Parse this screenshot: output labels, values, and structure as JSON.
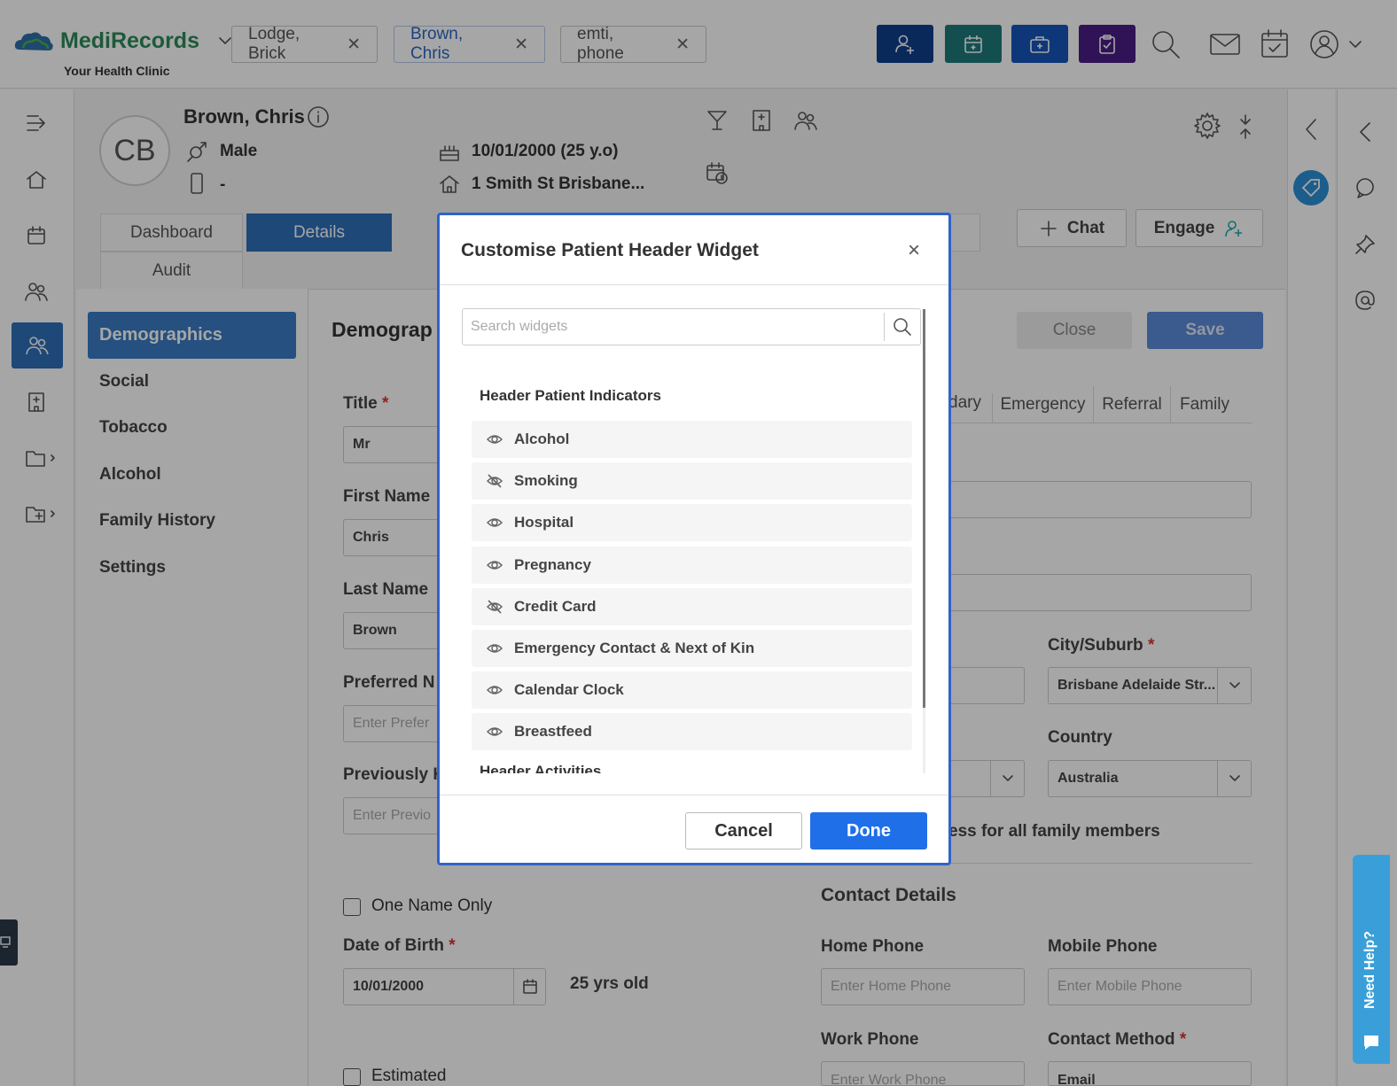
{
  "app": {
    "brand": "MediRecords",
    "clinic": "Your Health Clinic"
  },
  "patient_tabs": [
    {
      "label": "Lodge, Brick"
    },
    {
      "label": "Brown, Chris"
    },
    {
      "label": "emti, phone"
    }
  ],
  "quick_buttons": [
    {
      "icon": "add-patient-icon",
      "color": "#0f3f8c"
    },
    {
      "icon": "calendar-icon",
      "color": "#1f7a7c"
    },
    {
      "icon": "medical-kit-icon",
      "color": "#1455b8"
    },
    {
      "icon": "clipboard-icon",
      "color": "#4a1c85"
    }
  ],
  "patient": {
    "initials": "CB",
    "name": "Brown, Chris",
    "gender": "Male",
    "phone": "-",
    "dob": "10/01/2000 (25 y.o)",
    "address": "1 Smith St Brisbane..."
  },
  "page_tabs": {
    "dashboard": "Dashboard",
    "details": "Details",
    "audit": "Audit"
  },
  "actions": {
    "chat": "Chat",
    "engage": "Engage",
    "close": "Close",
    "save": "Save"
  },
  "subnav": {
    "items": [
      "Demographics",
      "Social",
      "Tobacco",
      "Alcohol",
      "Family History",
      "Settings"
    ]
  },
  "form": {
    "heading": "Demograp",
    "title_label": "Title",
    "title_value": "Mr",
    "first_name_label": "First Name",
    "first_name_value": "Chris",
    "last_name_label": "Last Name",
    "last_name_value": "Brown",
    "preferred_label": "Preferred N",
    "preferred_placeholder": "Enter Prefer",
    "previously_label": "Previously K",
    "previously_placeholder": "Enter Previo",
    "one_name_only": "One Name Only",
    "dob_label": "Date of Birth",
    "dob_value": "10/01/2000",
    "age_text": "25 yrs old",
    "estimated": "Estimated",
    "address_tabs": [
      "dary",
      "Emergency",
      "Referral",
      "Family"
    ],
    "city_label": "City/Suburb",
    "city_value": "Brisbane Adelaide Str...",
    "country_label": "Country",
    "country_value": "Australia",
    "family_text": "ess for all family members",
    "contact_heading": "Contact Details",
    "home_phone_label": "Home Phone",
    "home_phone_placeholder": "Enter Home Phone",
    "mobile_phone_label": "Mobile Phone",
    "mobile_phone_placeholder": "Enter Mobile Phone",
    "work_phone_label": "Work Phone",
    "work_phone_placeholder": "Enter Work Phone",
    "contact_method_label": "Contact Method",
    "contact_method_value": "Email",
    "required_mark": "*"
  },
  "modal": {
    "title": "Customise Patient Header Widget",
    "close_glyph": "×",
    "search_placeholder": "Search widgets",
    "section_heading": "Header Patient Indicators",
    "next_section_heading": "Header Activities",
    "items": [
      {
        "label": "Alcohol",
        "visible": true
      },
      {
        "label": "Smoking",
        "visible": false
      },
      {
        "label": "Hospital",
        "visible": true
      },
      {
        "label": "Pregnancy",
        "visible": true
      },
      {
        "label": "Credit Card",
        "visible": false
      },
      {
        "label": "Emergency Contact & Next of Kin",
        "visible": true
      },
      {
        "label": "Calendar Clock",
        "visible": true
      },
      {
        "label": "Breastfeed",
        "visible": true
      }
    ],
    "cancel": "Cancel",
    "done": "Done"
  },
  "help": {
    "label": "Need Help?"
  }
}
